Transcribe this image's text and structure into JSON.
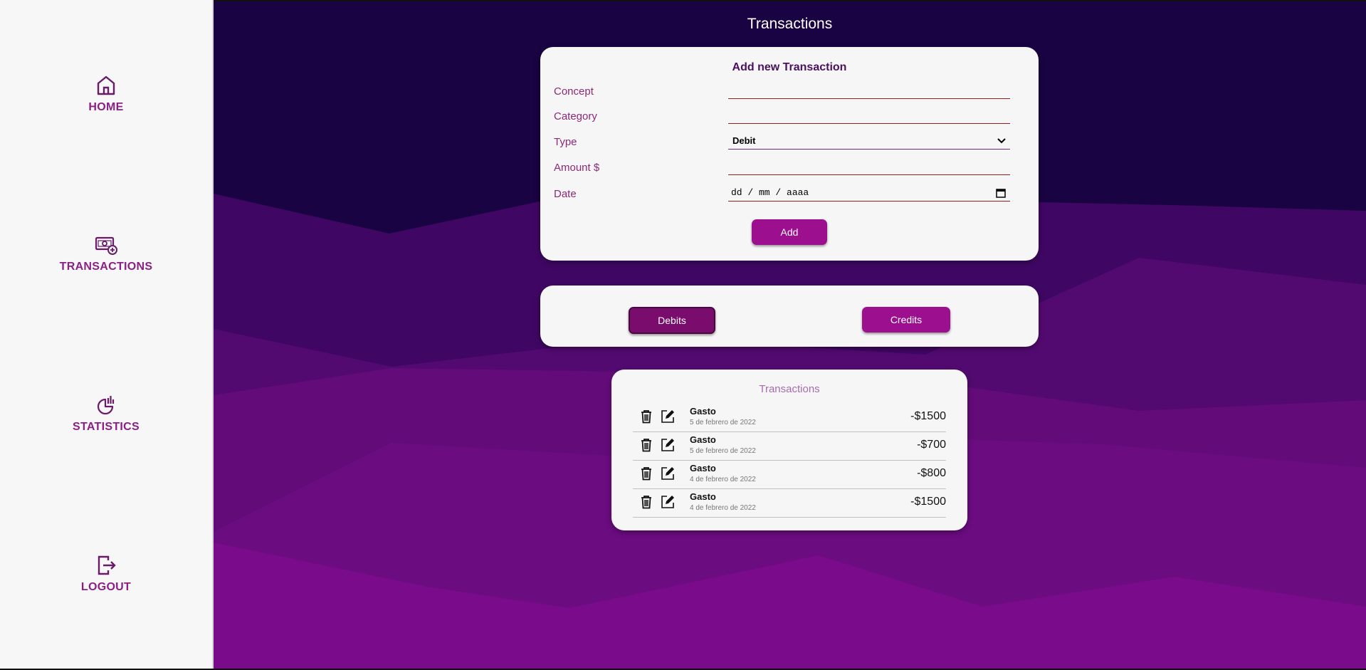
{
  "colors": {
    "sidebar_bg": "#f7f7f7",
    "accent": "#9c0f8f",
    "nav_text": "#8b1f86",
    "main_bg": "#1a0342",
    "card_bg": "#f6f6f6"
  },
  "sidebar": {
    "items": [
      {
        "label": "HOME",
        "icon": "home-icon"
      },
      {
        "label": "TRANSACTIONS",
        "icon": "money-add-icon"
      },
      {
        "label": "STATISTICS",
        "icon": "chart-icon"
      },
      {
        "label": "LOGOUT",
        "icon": "logout-icon"
      }
    ]
  },
  "page": {
    "title": "Transactions"
  },
  "form": {
    "title": "Add new Transaction",
    "fields": {
      "concept": {
        "label": "Concept",
        "value": ""
      },
      "category": {
        "label": "Category",
        "value": ""
      },
      "type": {
        "label": "Type",
        "value": "Debit"
      },
      "amount": {
        "label": "Amount $",
        "value": ""
      },
      "date": {
        "label": "Date",
        "placeholder": "dd / mm / aaaa"
      }
    },
    "add_label": "Add"
  },
  "filters": {
    "debits_label": "Debits",
    "credits_label": "Credits",
    "active": "debits"
  },
  "transactions": {
    "title": "Transactions",
    "rows": [
      {
        "concept": "Gasto",
        "date": "5 de febrero de 2022",
        "amount": "-$1500"
      },
      {
        "concept": "Gasto",
        "date": "5 de febrero de 2022",
        "amount": "-$700"
      },
      {
        "concept": "Gasto",
        "date": "4 de febrero de 2022",
        "amount": "-$800"
      },
      {
        "concept": "Gasto",
        "date": "4 de febrero de 2022",
        "amount": "-$1500"
      }
    ]
  }
}
